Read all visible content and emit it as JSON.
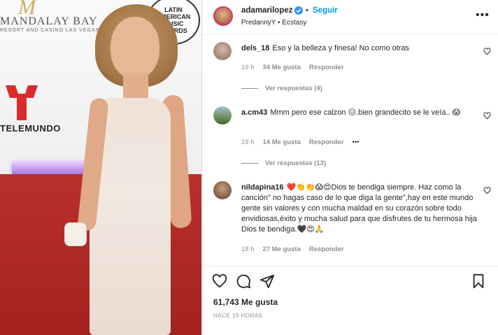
{
  "photo": {
    "sponsor_name": "MANDALAY BAY",
    "sponsor_sub": "RESORT AND CASINO  LAS VEGAS",
    "awards_lines": [
      "LATIN",
      "AMERICAN",
      "MUSIC",
      "AWARDS"
    ],
    "network": "TELEMUNDO"
  },
  "header": {
    "username": "adamarilopez",
    "separator": "•",
    "follow_label": "Seguir",
    "audio": "PredannyY • Ecstasy",
    "more": "•••"
  },
  "comments": [
    {
      "username": "dels_18",
      "text": "Eso y la belleza y finesa! No como otras",
      "time": "19 h",
      "likes": "34 Me gusta",
      "reply": "Responder",
      "view_replies": "Ver respuestas (4)"
    },
    {
      "username": "a.cm43",
      "text": "Mmm pero ese calzon 😑.bien grandecito se le veía.. 😱",
      "time": "19 h",
      "likes": "14 Me gusta",
      "reply": "Responder",
      "options": "•••",
      "view_replies": "Ver respuestas (13)"
    },
    {
      "username": "nildapina16",
      "text": "❤️👏👏😱😍Dios te bendiga siempre. Haz como la canción\" no hagas caso de lo que diga la gente\",hay en este mundo gente sin valores y con mucha maldad en su corazón sobre todo envidiosas,éxito y mucha salud para que disfrutes de tu hermosa hija Dios te bendiga.🖤😍🙏",
      "time": "18 h",
      "likes": "27 Me gusta",
      "reply": "Responder"
    }
  ],
  "likes_total": "61,743 Me gusta",
  "posted": "HACE 19 HORAS",
  "colors": {
    "follow": "#0095f6",
    "muted": "#8e8e8e",
    "text": "#262626",
    "carpet": "#b9302d"
  }
}
